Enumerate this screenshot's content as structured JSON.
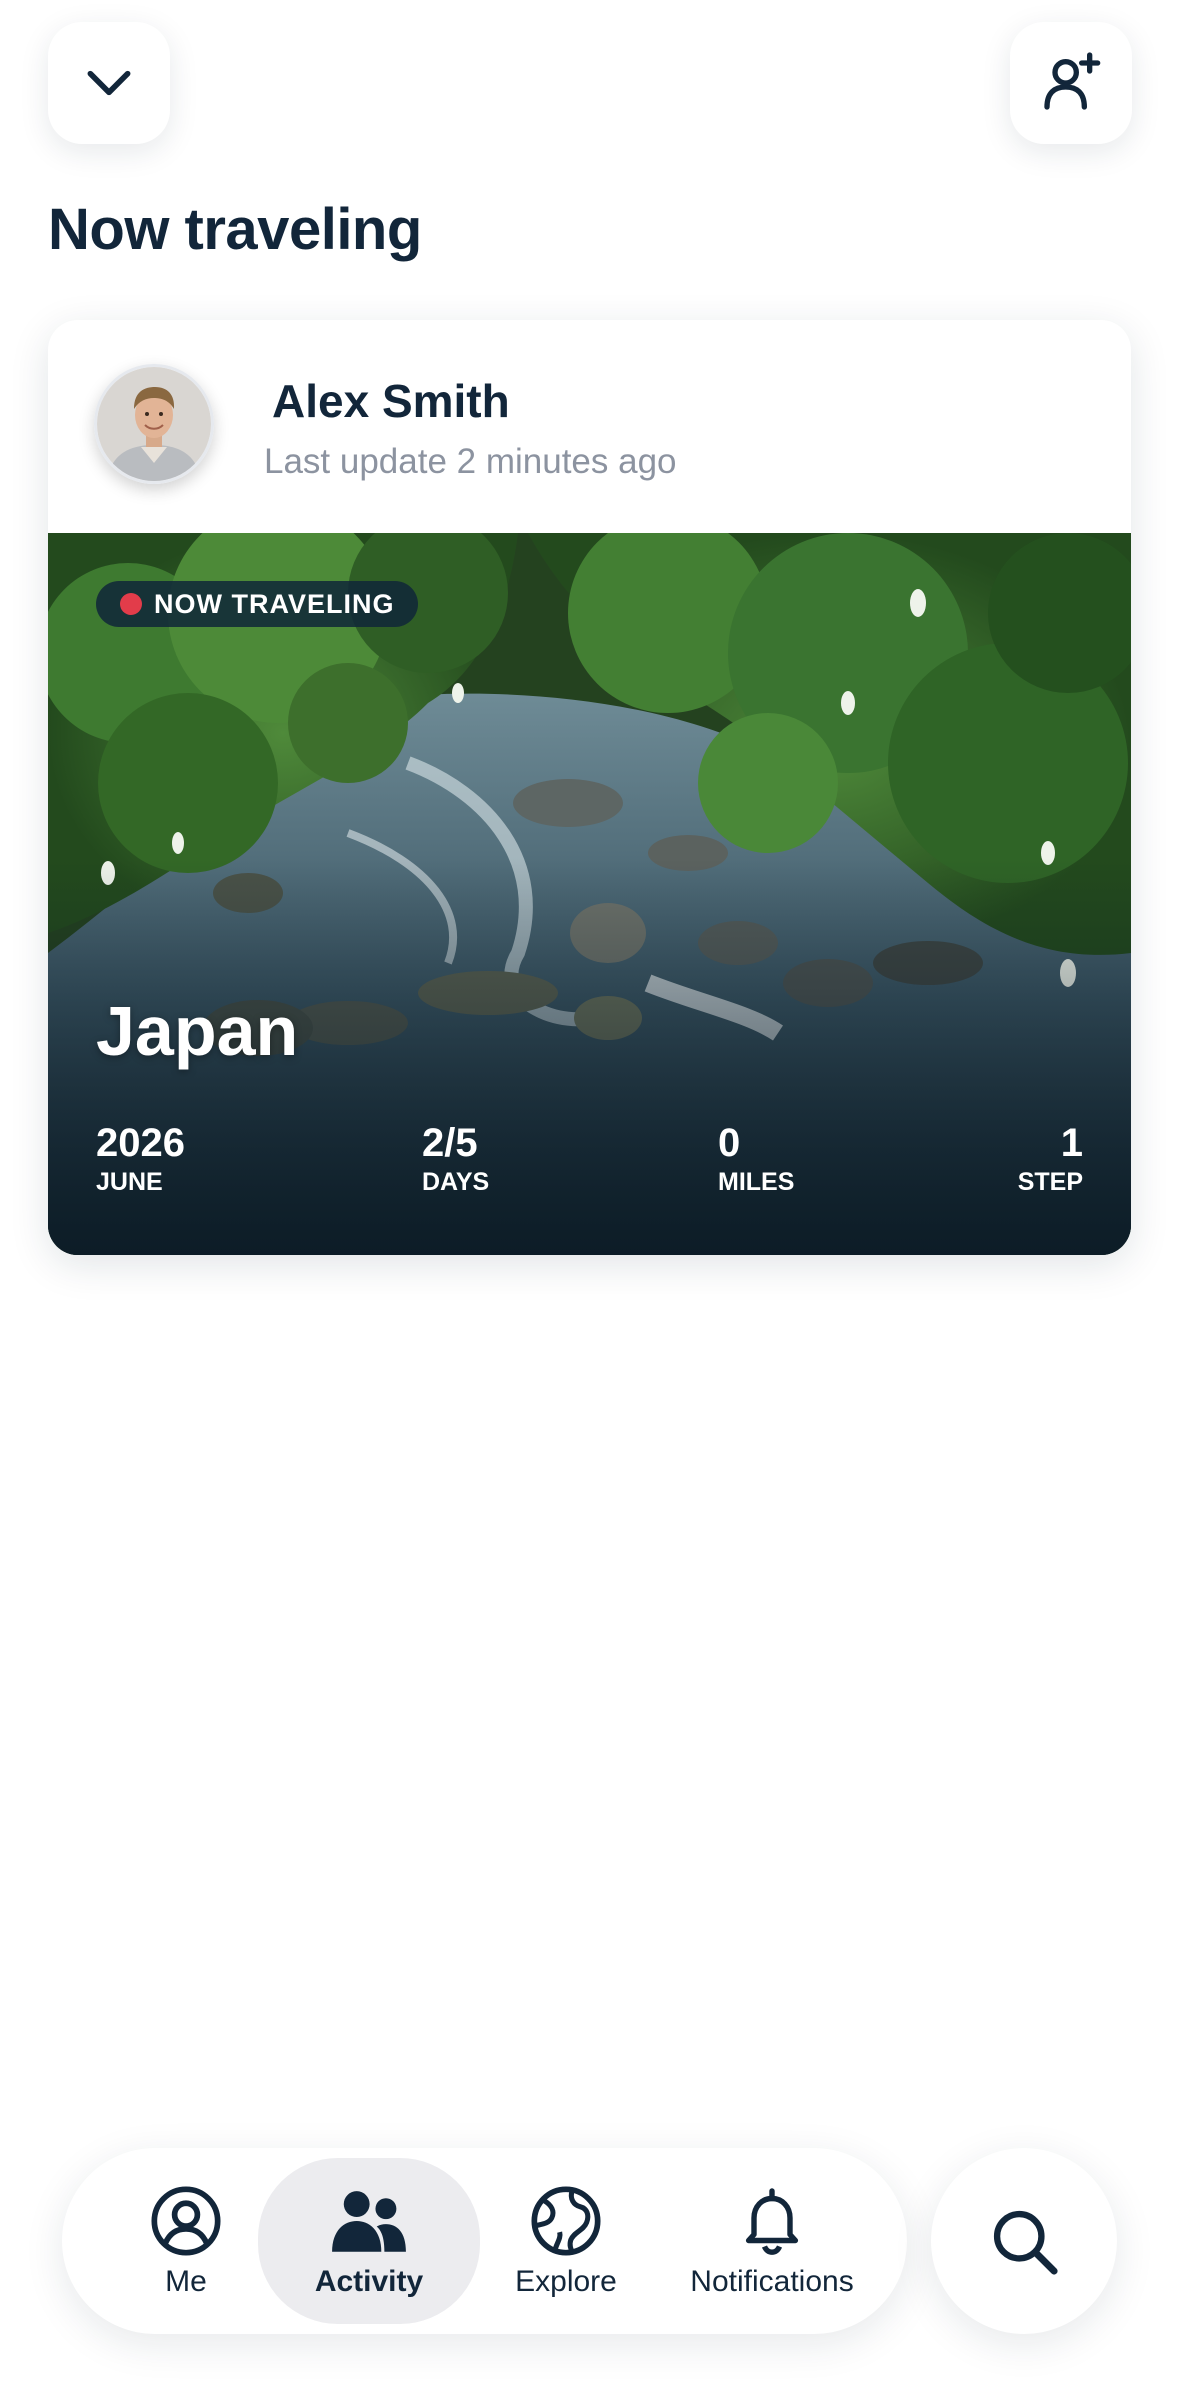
{
  "header": {
    "title": "Now traveling",
    "collapse_icon": "chevron-down-icon",
    "add_friend_icon": "add-person-icon"
  },
  "card": {
    "user_name": "Alex Smith",
    "last_update": "Last update 2 minutes ago",
    "badge": "NOW TRAVELING",
    "country": "Japan",
    "stats": [
      {
        "value": "2026",
        "label": "JUNE"
      },
      {
        "value": "2/5",
        "label": "DAYS"
      },
      {
        "value": "0",
        "label": "MILES"
      },
      {
        "value": "1",
        "label": "STEP"
      }
    ]
  },
  "nav": {
    "items": [
      {
        "label": "Me",
        "icon": "profile-icon"
      },
      {
        "label": "Activity",
        "icon": "people-icon",
        "active": true
      },
      {
        "label": "Explore",
        "icon": "globe-icon"
      },
      {
        "label": "Notifications",
        "icon": "bell-icon"
      }
    ],
    "search_icon": "search-icon"
  },
  "colors": {
    "text_primary": "#12263a",
    "text_secondary": "#8c93a0",
    "badge_dot": "#e23c4a",
    "active_tab_bg": "#ececef"
  }
}
